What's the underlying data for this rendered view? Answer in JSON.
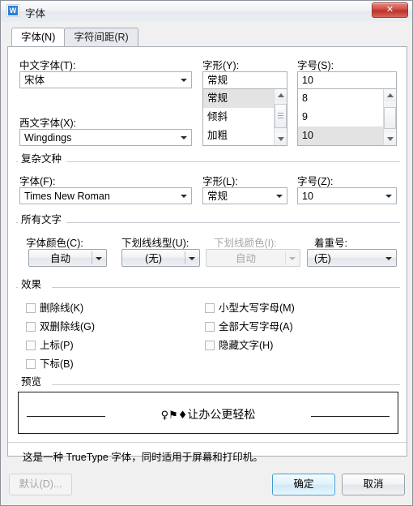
{
  "window": {
    "title": "字体",
    "icon": "wps-writer-icon",
    "icon_letter": "W",
    "close_label": "✕"
  },
  "tabs": [
    {
      "label": "字体(N)",
      "active": true
    },
    {
      "label": "字符间距(R)",
      "active": false
    }
  ],
  "latin_section": {
    "chinese_font": {
      "label": "中文字体(T):",
      "value": "宋体",
      "selected": true
    },
    "western_font": {
      "label": "西文字体(X):",
      "value": "Wingdings"
    },
    "font_style": {
      "label": "字形(Y):",
      "value": "常规",
      "options": [
        "常规",
        "倾斜",
        "加粗"
      ],
      "selected_index": 0
    },
    "font_size": {
      "label": "字号(S):",
      "value": "10",
      "options": [
        "8",
        "9",
        "10"
      ],
      "selected_index": 2
    }
  },
  "complex_section": {
    "title": "复杂文种",
    "font": {
      "label": "字体(F):",
      "value": "Times New Roman"
    },
    "style": {
      "label": "字形(L):",
      "value": "常规"
    },
    "size": {
      "label": "字号(Z):",
      "value": "10"
    }
  },
  "all_text_section": {
    "title": "所有文字",
    "font_color": {
      "label": "字体颜色(C):",
      "value": "自动",
      "disabled": false
    },
    "underline_style": {
      "label": "下划线线型(U):",
      "value": "(无)",
      "disabled": false
    },
    "underline_color": {
      "label": "下划线颜色(I):",
      "value": "自动",
      "disabled": true
    },
    "emphasis_mark": {
      "label": "着重号:",
      "value": "(无)",
      "disabled": false
    }
  },
  "effects_section": {
    "title": "效果",
    "left_column": [
      {
        "label": "删除线(K)",
        "checked": false
      },
      {
        "label": "双删除线(G)",
        "checked": false
      },
      {
        "label": "上标(P)",
        "checked": false
      },
      {
        "label": "下标(B)",
        "checked": false
      }
    ],
    "right_column": [
      {
        "label": "小型大写字母(M)",
        "checked": false
      },
      {
        "label": "全部大写字母(A)",
        "checked": false
      },
      {
        "label": "隐藏文字(H)",
        "checked": false
      }
    ]
  },
  "preview_section": {
    "title": "预览",
    "symbols": "♀⚑♦",
    "text": "让办公更轻松",
    "note": "这是一种 TrueType 字体，同时适用于屏幕和打印机。"
  },
  "footer": {
    "default_button": {
      "label": "默认(D)...",
      "disabled": true
    },
    "ok_button": {
      "label": "确定",
      "default": true
    },
    "cancel_button": {
      "label": "取消",
      "default": false
    }
  }
}
